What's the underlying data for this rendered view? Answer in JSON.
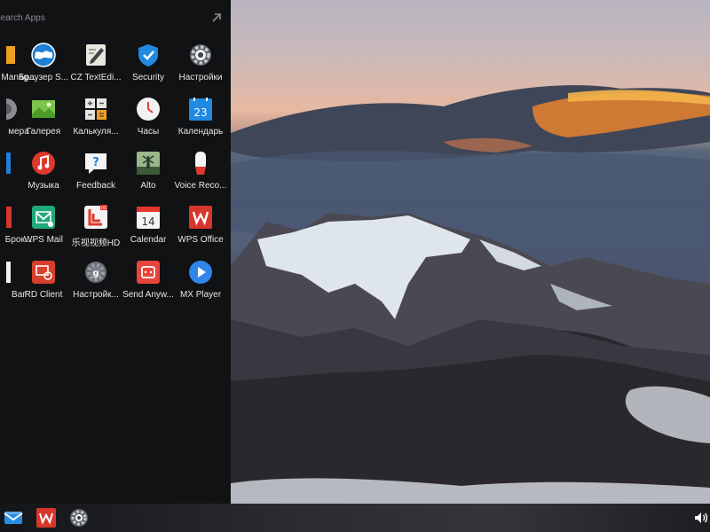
{
  "drawer": {
    "search_placeholder": "Search Apps",
    "expand_icon": "arrow-up-right-icon",
    "apps": [
      {
        "label": "Manag...",
        "icon": "folder-icon"
      },
      {
        "label": "Браузер S...",
        "icon": "globe-browser-icon"
      },
      {
        "label": "CZ TextEdi...",
        "icon": "text-editor-icon"
      },
      {
        "label": "Security",
        "icon": "shield-icon"
      },
      {
        "label": "Настройки",
        "icon": "gear-icon"
      },
      {
        "label": "мера",
        "icon": "camera-icon"
      },
      {
        "label": "Галерея",
        "icon": "gallery-icon"
      },
      {
        "label": "Калькуля...",
        "icon": "calculator-icon"
      },
      {
        "label": "Часы",
        "icon": "clock-icon"
      },
      {
        "label": "Календарь",
        "icon": "calendar-icon"
      },
      {
        "label": "",
        "icon": "blue-app-icon"
      },
      {
        "label": "Музыка",
        "icon": "music-icon"
      },
      {
        "label": "Feedback",
        "icon": "feedback-icon"
      },
      {
        "label": "Alto",
        "icon": "alto-game-icon"
      },
      {
        "label": "Voice Reco...",
        "icon": "voice-recorder-icon"
      },
      {
        "label": "Брок...",
        "icon": "red-app-icon"
      },
      {
        "label": "WPS Mail",
        "icon": "wps-mail-icon"
      },
      {
        "label": "乐视视频HD",
        "icon": "letv-video-icon"
      },
      {
        "label": "Calendar",
        "icon": "calendar-14-icon"
      },
      {
        "label": "WPS Office",
        "icon": "wps-office-icon"
      },
      {
        "label": "Ваг",
        "icon": "white-app-icon"
      },
      {
        "label": "RD Client",
        "icon": "remote-desktop-icon"
      },
      {
        "label": "Настройк...",
        "icon": "google-settings-icon"
      },
      {
        "label": "Send Anyw...",
        "icon": "send-anywhere-icon"
      },
      {
        "label": "MX Player",
        "icon": "mx-player-icon"
      }
    ]
  },
  "taskbar": {
    "items": [
      {
        "name": "mail-icon"
      },
      {
        "name": "wps-office-icon"
      },
      {
        "name": "settings-icon"
      }
    ],
    "volume_icon": "volume-icon"
  },
  "colors": {
    "drawer_bg": "#111214",
    "taskbar_bg": "#24252a",
    "label_text": "#e6e6e6"
  }
}
